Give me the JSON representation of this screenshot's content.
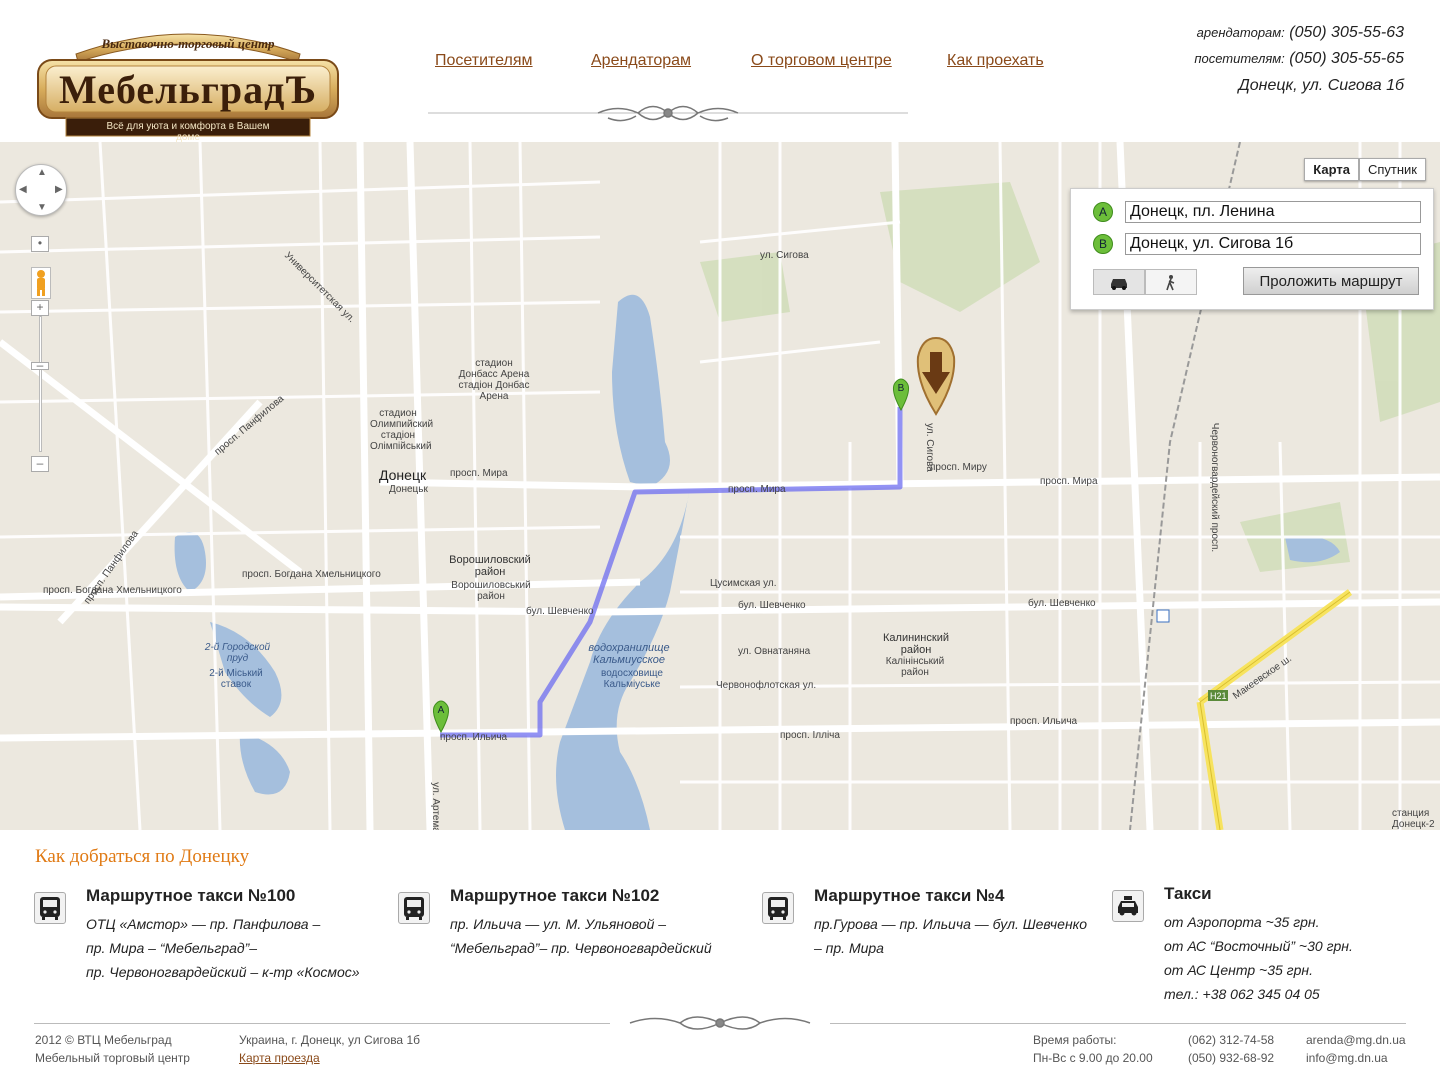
{
  "header": {
    "logo_top": "Выставочно-торговый центр",
    "logo_title": "МебельградЪ",
    "logo_sub": "Всё для уюта и комфорта в Вашем доме",
    "nav": [
      "Посетителям",
      "Арендаторам",
      "О торговом центре",
      "Как проехать"
    ],
    "contacts": {
      "tenants_label": "арендаторам:",
      "tenants_phone": "(050) 305-55-63",
      "visitors_label": "посетителям:",
      "visitors_phone": "(050) 305-55-65",
      "address": "Донецк, ул. Сигова 1б"
    }
  },
  "map": {
    "type_map": "Карта",
    "type_sat": "Спутник",
    "from": "Донецк, пл. Ленина",
    "to": "Донецк, ул. Сигова 1б",
    "badge_a": "A",
    "badge_b": "B",
    "route_button": "Проложить маршрут",
    "labels": {
      "donetsk": "Донецк",
      "donetsk_ua": "Донецьк",
      "voroshilov": "Ворошиловский район",
      "voroshilov_ua": "Ворошиловський район",
      "kalinin": "Калининский район",
      "kalinin_ua": "Калінінський район",
      "reservoir": "водохранилище Кальмиусское",
      "reservoir_ua": "водосховище Кальміуське",
      "pond": "2-й Городской пруд",
      "pond_ua": "2-й Міський ставок",
      "stadium1": "стадион Донбасс Арена",
      "stadium1_ua": "стадіон Донбас Арена",
      "stadium2": "стадион Олимпийский",
      "stadium2_ua": "стадіон Олімпійський",
      "mira": "просп. Мира",
      "mira2": "просп. Миру",
      "ilicha": "просп. Ильича",
      "ilicha2": "просп. Ілліча",
      "shevchenko": "бул. Шевченко",
      "khmelnitsky": "просп. Богдана Хмельницкого",
      "panfilova": "просп. Панфилова",
      "artema": "ул. Артема",
      "sigova": "ул. Сигова",
      "makeevskoe": "Макеевское ш.",
      "tsusimskaya": "Цусимская ул.",
      "ovnatanyana": "ул. Овнатаняна",
      "chervonoflotskaya": "Червонофлотская ул.",
      "universitetskaya": "Университетская ул.",
      "chervonogvardeysky": "Червоногвардейский просп.",
      "station": "станция Донецк-2",
      "h21": "H21"
    }
  },
  "how_title": "Как добраться по Донецку",
  "transport": [
    {
      "title": "Маршрутное такси №100",
      "lines": [
        "ОТЦ «Амстор» — пр. Панфилова –",
        "пр. Мира – “Мебельград”–",
        "пр. Червоногвардейский – к-тр «Космос»"
      ]
    },
    {
      "title": "Маршрутное такси №102",
      "lines": [
        "пр. Ильича — ул. М. Ульяновой –",
        "“Мебельград”– пр. Червоногвардейский"
      ]
    },
    {
      "title": "Маршрутное такси №4",
      "lines": [
        "пр.Гурова — пр. Ильича — бул. Шевченко",
        "– пр. Мира"
      ]
    },
    {
      "title": "Такси",
      "lines": [
        "от Аэропорта ~35 грн.",
        "от АС “Восточный” ~30 грн.",
        "от АС Центр ~35 грн.",
        "тел.: +38 062 345 04 05"
      ]
    }
  ],
  "footer": {
    "copy1": "2012 © ВТЦ Мебельград",
    "copy2": "Мебельный торговый центр",
    "addr": "Украина, г. Донецк, ул Сигова 1б",
    "map_link": "Карта проезда",
    "hours_label": "Время работы:",
    "hours": "Пн-Вс с 9.00 до 20.00",
    "phone1": "(062) 312-74-58",
    "phone2": "(050) 932-68-92",
    "email1": "arenda@mg.dn.ua",
    "email2": "info@mg.dn.ua"
  },
  "colors": {
    "accent": "#e07a14",
    "link": "#8a4a1a",
    "route": "#7b7bef",
    "water": "#a5bfdd",
    "marker": "#6cbe3a"
  }
}
